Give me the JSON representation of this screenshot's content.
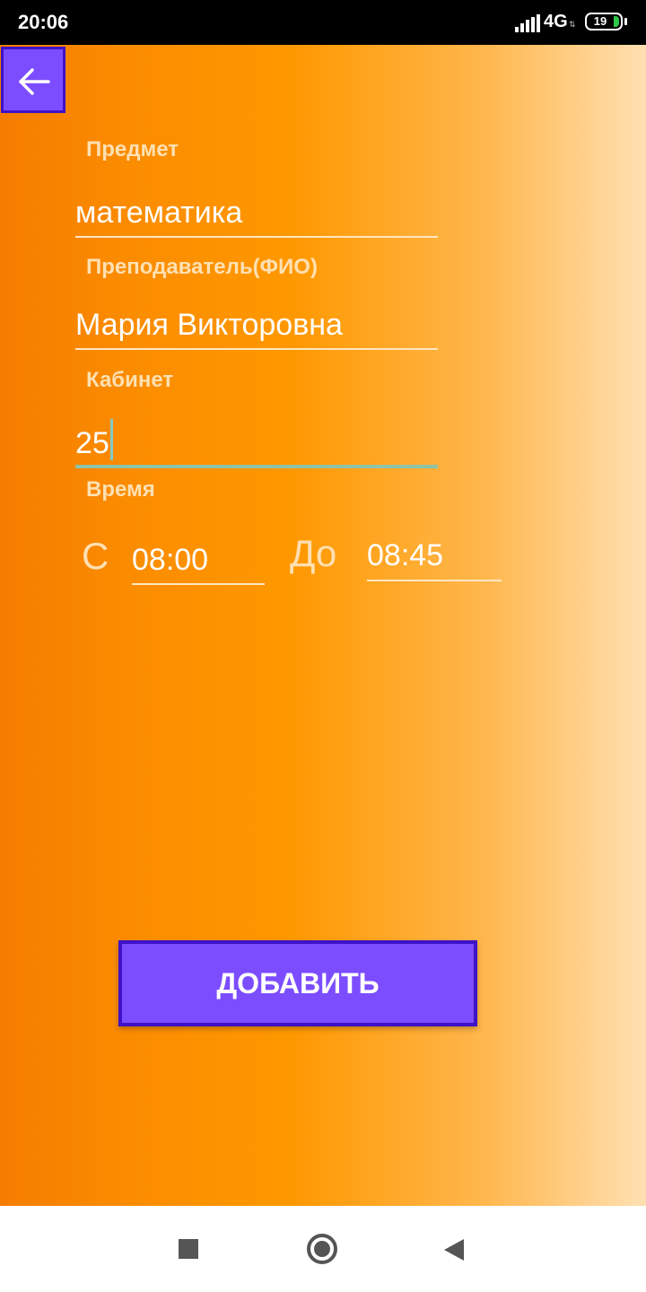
{
  "status_bar": {
    "time": "20:06",
    "network": "4G",
    "battery": "19",
    "signal_icon": "signal-icon",
    "battery_color": "#2ec84a"
  },
  "colors": {
    "accent": "#7c4dff",
    "accent_border": "#3d12c9",
    "gradient_start": "#f57c00",
    "gradient_end": "#ffe0b2",
    "active_underline": "#8ec3a8"
  },
  "toolbar": {
    "back_icon": "arrow-left-icon"
  },
  "form": {
    "subject_label": "Предмет",
    "subject_value": "математика",
    "teacher_label": "Преподаватель(ФИО)",
    "teacher_value": "Мария Викторовна",
    "room_label": "Кабинет",
    "room_value": "25",
    "time_label": "Время",
    "from_prefix": "С",
    "from_value": "08:00",
    "to_prefix": "До",
    "to_value": "08:45"
  },
  "add_button_label": "ДОБАВИТЬ",
  "nav_bar": {
    "recents_icon": "square-icon",
    "home_icon": "circle-icon",
    "back_icon": "triangle-back-icon"
  }
}
